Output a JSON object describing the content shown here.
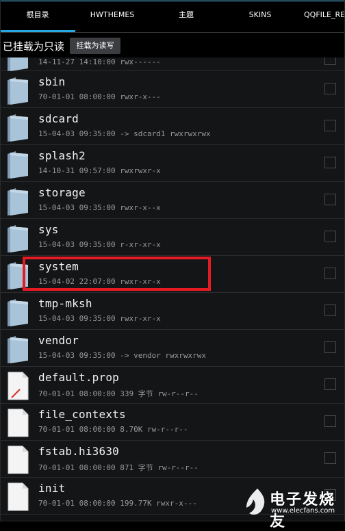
{
  "tabs": [
    {
      "label": "根目录"
    },
    {
      "label": "HWTHEMES"
    },
    {
      "label": "主题"
    },
    {
      "label": "SKINS"
    },
    {
      "label": "QQFILE_RE"
    }
  ],
  "mount": {
    "status": "已挂载为只读",
    "button": "挂载为读写"
  },
  "files": [
    {
      "name": "",
      "meta": "14-11-27 14:10:00  rwx------",
      "type": "folder"
    },
    {
      "name": "sbin",
      "meta": "70-01-01 08:00:00  rwxr-x---",
      "type": "folder"
    },
    {
      "name": "sdcard",
      "meta": "15-04-03 09:35:00 -> sdcard1 rwxrwxrwx",
      "type": "folder"
    },
    {
      "name": "splash2",
      "meta": "14-10-31 09:57:00  rwxrwxr-x",
      "type": "folder"
    },
    {
      "name": "storage",
      "meta": "15-04-03 09:35:00  rwxr-x--x",
      "type": "folder"
    },
    {
      "name": "sys",
      "meta": "15-04-03 09:35:00  r-xr-xr-x",
      "type": "folder"
    },
    {
      "name": "system",
      "meta": "15-04-02 22:07:00  rwxr-xr-x",
      "type": "folder"
    },
    {
      "name": "tmp-mksh",
      "meta": "15-04-03 09:35:00  rwxr-xr-x",
      "type": "folder"
    },
    {
      "name": "vendor",
      "meta": "15-04-03 09:35:00 -> vendor rwxrwxrwx",
      "type": "folder"
    },
    {
      "name": "default.prop",
      "meta": "70-01-01 08:00:00 339 字节 rw-r--r--",
      "type": "file-prop"
    },
    {
      "name": "file_contexts",
      "meta": "70-01-01 08:00:00 8.70K rw-r--r--",
      "type": "file"
    },
    {
      "name": "fstab.hi3630",
      "meta": "70-01-01 08:00:00 871 字节 rw-r--r--",
      "type": "file"
    },
    {
      "name": "init",
      "meta": "70-01-01 08:00:00 199.77K rwxr-x---",
      "type": "file"
    }
  ],
  "watermark": {
    "title": "电子发烧友",
    "url": "www.elecfans.com"
  },
  "colors": {
    "accent": "#26a8e0",
    "highlight": "#e51b24",
    "folder": "#a9c3d8"
  }
}
